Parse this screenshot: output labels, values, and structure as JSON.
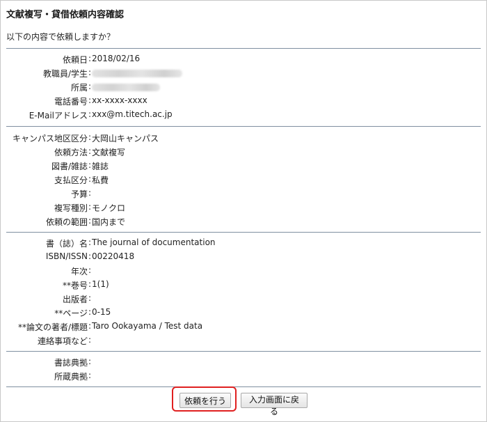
{
  "page": {
    "title": "文献複写・貸借依頼内容確認",
    "question": "以下の内容で依頼しますか？"
  },
  "sections": [
    {
      "fields": [
        {
          "label": "依頼日",
          "value": "2018/02/16"
        },
        {
          "label": "教職員/学生",
          "value": "",
          "redacted": true
        },
        {
          "label": "所属",
          "value": "",
          "redacted": true
        },
        {
          "label": "電話番号",
          "value": "xx-xxxx-xxxx"
        },
        {
          "label": "E-Mailアドレス",
          "value": "xxx@m.titech.ac.jp"
        }
      ]
    },
    {
      "fields": [
        {
          "label": "キャンパス地区区分",
          "value": "大岡山キャンパス"
        },
        {
          "label": "依頼方法",
          "value": "文献複写"
        },
        {
          "label": "図書/雑誌",
          "value": "雑誌"
        },
        {
          "label": "支払区分",
          "value": "私費"
        },
        {
          "label": "予算",
          "value": ""
        },
        {
          "label": "複写種別",
          "value": "モノクロ"
        },
        {
          "label": "依頼の範囲",
          "value": "国内まで"
        }
      ]
    },
    {
      "fields": [
        {
          "label": "書（誌）名",
          "value": "The journal of documentation"
        },
        {
          "label": "ISBN/ISSN",
          "value": "00220418"
        },
        {
          "label": "年次",
          "value": ""
        },
        {
          "label": "**巻号",
          "value": "1(1)"
        },
        {
          "label": "出版者",
          "value": ""
        },
        {
          "label": "**ページ",
          "value": "0-15"
        },
        {
          "label": "**論文の著者/標題",
          "value": "Taro Ookayama / Test data"
        },
        {
          "label": "連絡事項など",
          "value": ""
        }
      ]
    },
    {
      "fields": [
        {
          "label": "書誌典拠",
          "value": ""
        },
        {
          "label": "所蔵典拠",
          "value": ""
        }
      ]
    }
  ],
  "buttons": {
    "submit_label": "依頼を行う",
    "back_label": "入力画面に戻る"
  },
  "colors": {
    "rule": "#7f8fa0",
    "highlight": "#e02020"
  }
}
